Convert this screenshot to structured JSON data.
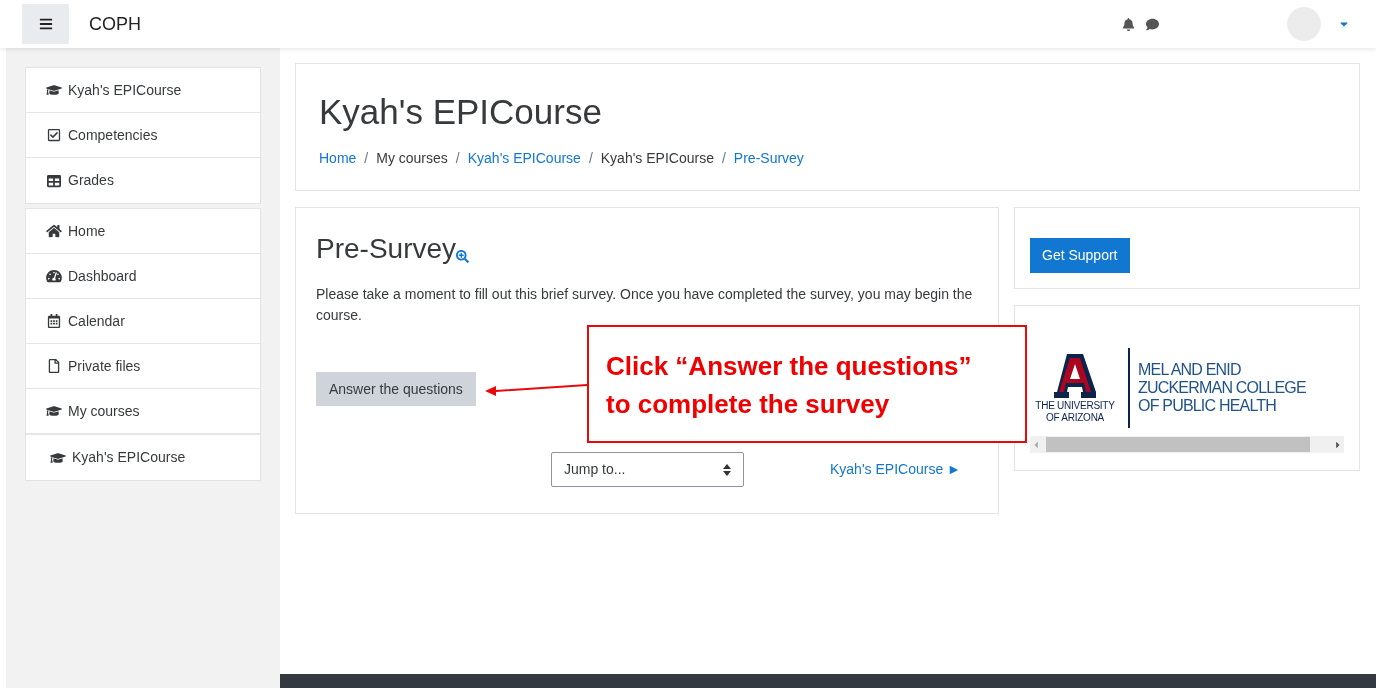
{
  "navbar": {
    "site_name": "COPH"
  },
  "sidebar": {
    "groups": [
      {
        "items": [
          {
            "label": "Kyah's EPICourse"
          },
          {
            "label": "Competencies"
          },
          {
            "label": "Grades"
          }
        ]
      },
      {
        "items": [
          {
            "label": "Home"
          },
          {
            "label": "Dashboard"
          },
          {
            "label": "Calendar"
          },
          {
            "label": "Private files"
          },
          {
            "label": "My courses",
            "children": [
              {
                "label": "Kyah's EPICourse"
              }
            ]
          }
        ]
      }
    ]
  },
  "page_header": {
    "title": "Kyah's EPICourse",
    "separator": "/",
    "breadcrumb": [
      {
        "label": "Home",
        "link": true
      },
      {
        "label": "My courses",
        "link": false
      },
      {
        "label": "Kyah's EPICourse",
        "link": true
      },
      {
        "label": "Kyah's EPICourse",
        "link": false
      },
      {
        "label": "Pre-Survey",
        "link": true
      }
    ]
  },
  "activity": {
    "title": "Pre-Survey",
    "description": "Please take a moment to fill out this brief survey. Once you have completed the survey, you may begin the course.",
    "button": "Answer the questions",
    "jump_select": {
      "value": "Jump to..."
    },
    "next_link": "Kyah's EPICourse ►"
  },
  "support_block": {
    "button": "Get Support"
  },
  "logo_block": {
    "university": [
      "THE UNIVERSITY",
      "OF ARIZONA"
    ],
    "college": [
      "MEL AND ENID",
      "ZUCKERMAN COLLEGE",
      "OF PUBLIC HEALTH"
    ]
  },
  "annotation": {
    "text": "Click “Answer the questions” to complete the survey"
  }
}
